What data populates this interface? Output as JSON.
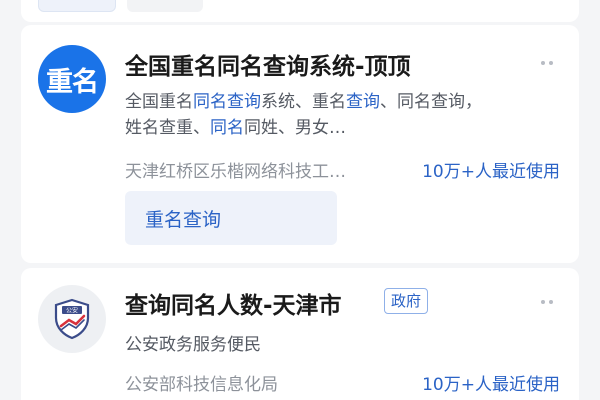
{
  "results": [
    {
      "logo_text": "重名",
      "title": "全国重名同名查询系统-顶顶",
      "description_line1": [
        {
          "text": "全国重名",
          "hl": false
        },
        {
          "text": "同名查询",
          "hl": true
        },
        {
          "text": "系统、重名",
          "hl": false
        },
        {
          "text": "查询",
          "hl": true
        },
        {
          "text": "、同名查询，",
          "hl": false
        }
      ],
      "description_line2": [
        {
          "text": "姓名查重、",
          "hl": false
        },
        {
          "text": "同名",
          "hl": true
        },
        {
          "text": "同姓、男女…",
          "hl": false
        }
      ],
      "source": "天津红桥区乐楷网络科技工…",
      "usage": "10万+人最近使用",
      "action_label": "重名查询"
    },
    {
      "logo_icon": "police-shield-icon",
      "logo_text": "公安",
      "title": "查询同名人数-天津市",
      "badge": "政府",
      "description": "公安政务服务便民",
      "source": "公安部科技信息化局",
      "usage": "10万+人最近使用"
    }
  ],
  "colors": {
    "accent": "#2b63c6",
    "logo_blue": "#1a73e8",
    "background": "#f4f5f7"
  }
}
